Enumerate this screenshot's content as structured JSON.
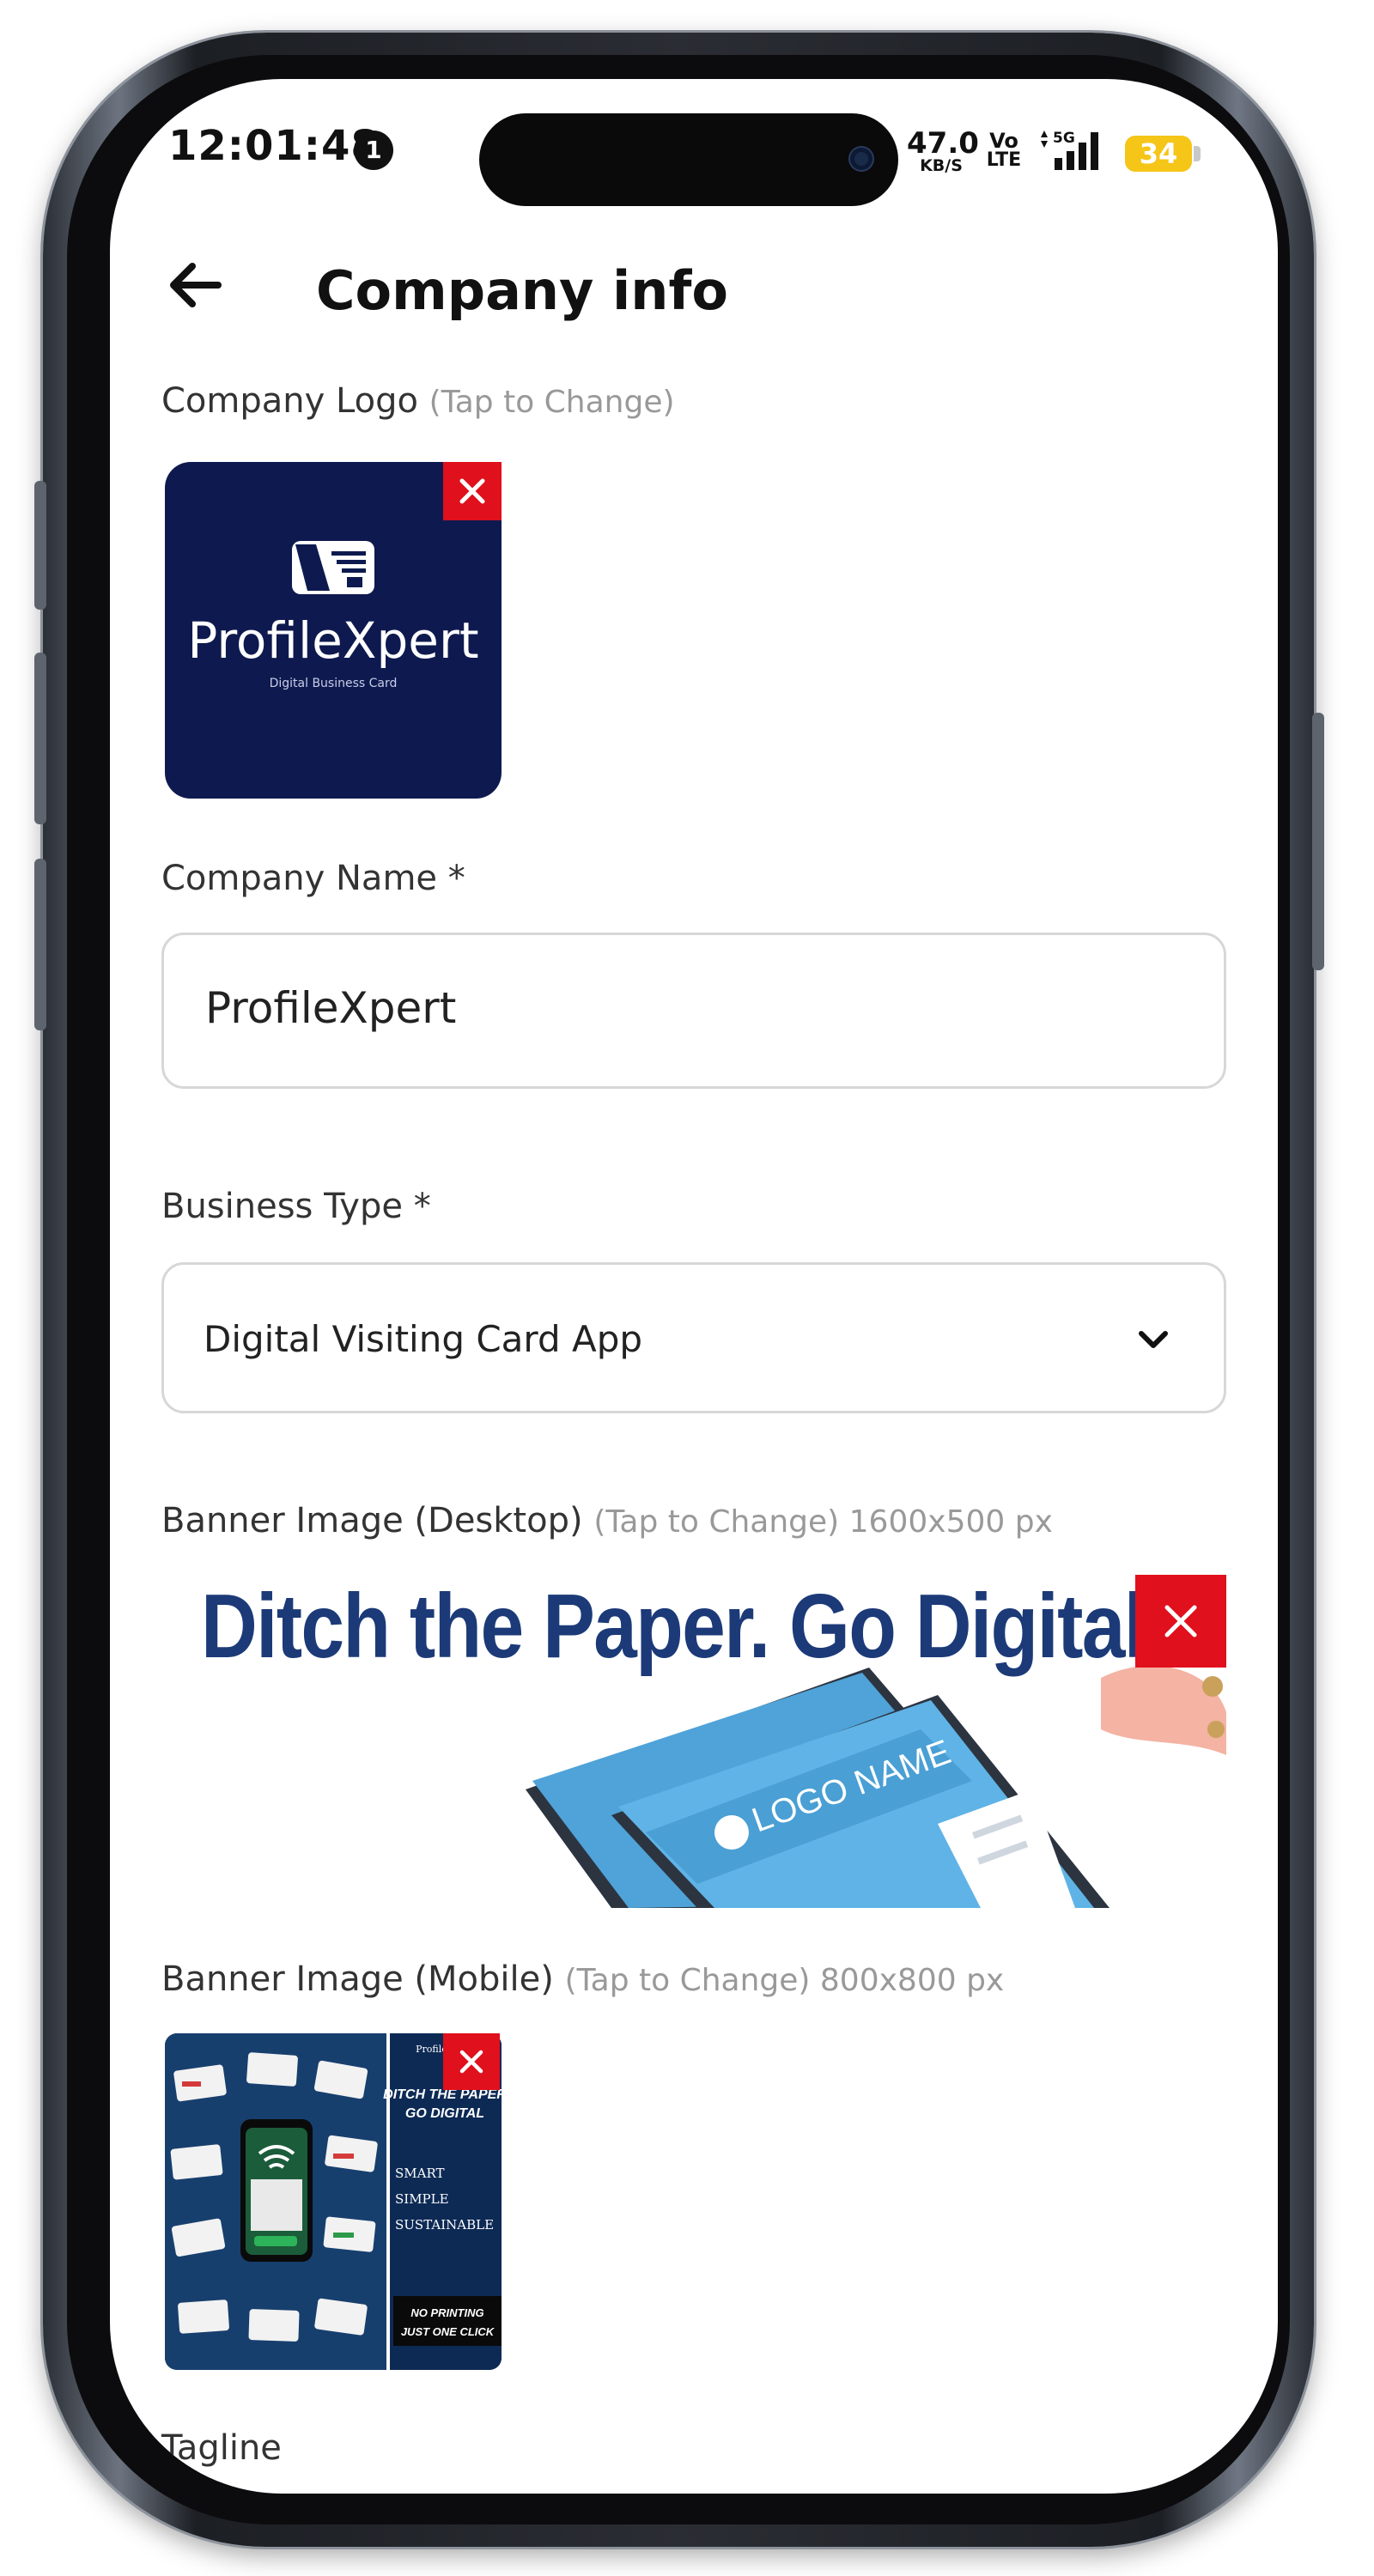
{
  "status_bar": {
    "time": "12:01:48",
    "notification_count": "1",
    "net_speed_value": "47.0",
    "net_speed_unit": "KB/S",
    "volte_top": "Vo",
    "volte_bottom": "LTE",
    "network_type": "5G",
    "battery_level": "34"
  },
  "header": {
    "title": "Company info",
    "back_icon": "arrow-left-icon"
  },
  "company_logo": {
    "label": "Company Logo",
    "hint": "(Tap to Change)",
    "logo_text": "ProfileXpert",
    "logo_subtext": "Digital Business Card",
    "remove_icon": "close-icon"
  },
  "company_name": {
    "label": "Company Name *",
    "value": "ProfileXpert"
  },
  "business_type": {
    "label": "Business Type *",
    "value": "Digital Visiting Card App",
    "dropdown_icon": "chevron-down-icon"
  },
  "banner_desktop": {
    "label": "Banner Image (Desktop)",
    "hint": "(Tap to Change) 1600x500 px",
    "headline": "Ditch the Paper. Go Digital.",
    "card_text": "LOGO NAME",
    "remove_icon": "close-icon"
  },
  "banner_mobile": {
    "label": "Banner Image (Mobile)",
    "hint": "(Tap to Change) 800x800 px",
    "brand": "ProfileXpert",
    "headline_line1": "DITCH THE PAPER",
    "headline_line2": "GO DIGITAL",
    "word1": "SMART",
    "word2": "SIMPLE",
    "word3": "SUSTAINABLE",
    "footer_line1": "NO PRINTING",
    "footer_line2": "JUST ONE CLICK",
    "remove_icon": "close-icon"
  },
  "tagline": {
    "label": "Tagline"
  },
  "colors": {
    "accent_red": "#e0101d",
    "logo_navy": "#0e1a4f",
    "battery_yellow": "#f5c518"
  }
}
